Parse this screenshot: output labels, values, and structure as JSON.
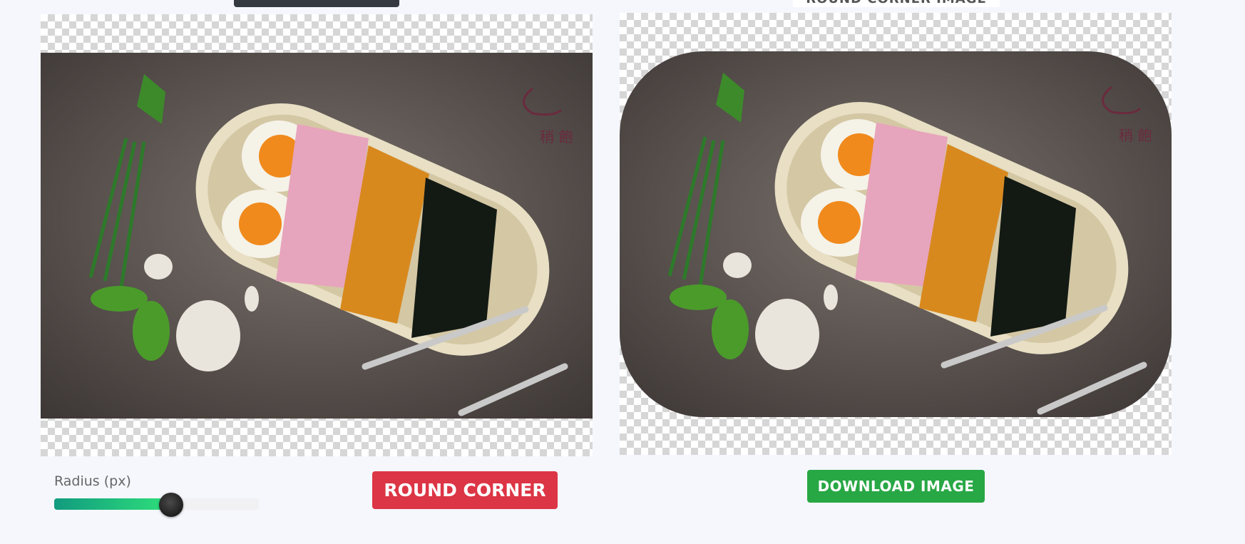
{
  "header": {
    "result_heading": "ROUND CORNER IMAGE"
  },
  "original_image": {
    "alt": "Food bowl with eggs, ham, pork belly and greens on dark table",
    "watermark_text": "稍 飽"
  },
  "result_image": {
    "alt": "Rounded corner version of the food bowl image",
    "watermark_text": "稍 飽"
  },
  "controls": {
    "radius_label": "Radius (px)",
    "radius_value_fraction": 0.57,
    "round_corner_label": "ROUND CORNER",
    "download_label": "DOWNLOAD IMAGE"
  },
  "colors": {
    "page_bg": "#f5f7fd",
    "round_button": "#dc3545",
    "download_button": "#28a745",
    "slider_start": "#119b7f",
    "slider_end": "#2fe07a"
  },
  "icons": {
    "slider_thumb": "slider-thumb-icon"
  }
}
